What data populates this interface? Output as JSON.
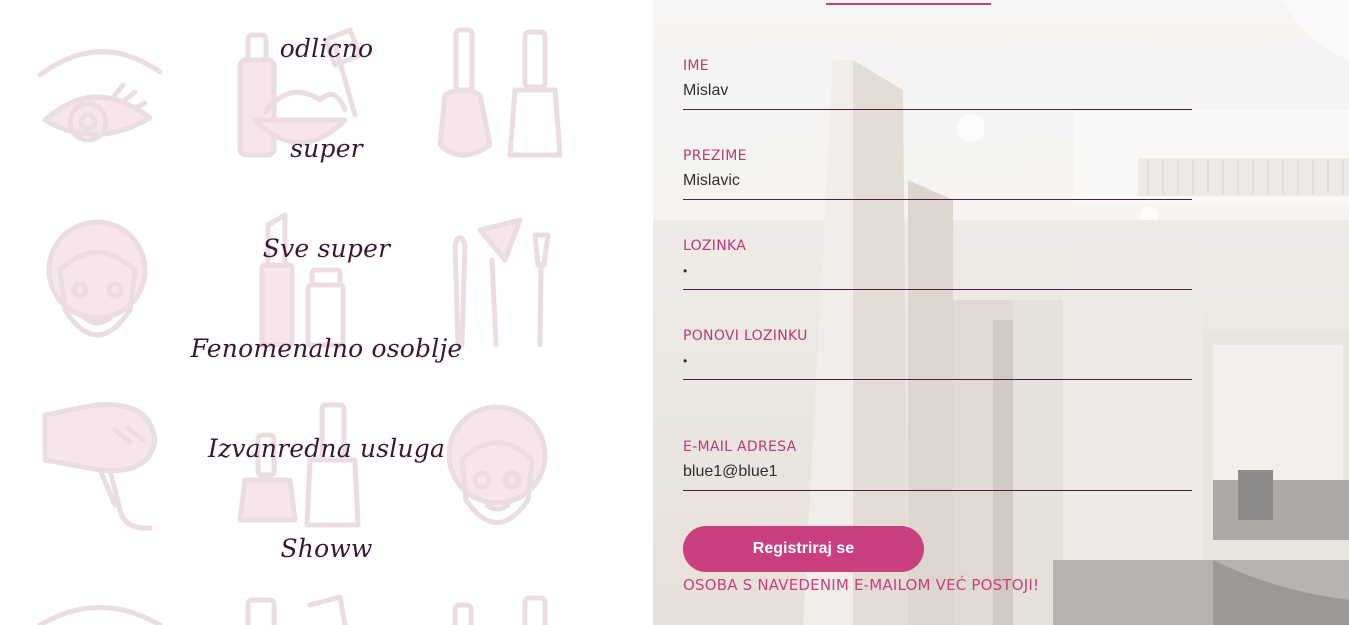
{
  "reviews": [
    "odlicno",
    "super",
    "Sve super",
    "Fenomenalno osoblje",
    "Izvanredna usluga",
    "Showw"
  ],
  "form": {
    "ime": {
      "label": "IME",
      "value": "Mislav"
    },
    "prezime": {
      "label": "PREZIME",
      "value": "Mislavic"
    },
    "lozinka": {
      "label": "LOZINKA",
      "value": "•"
    },
    "ponovi": {
      "label": "PONOVI LOZINKU",
      "value": "•"
    },
    "email": {
      "label": "E-MAIL ADRESA",
      "value": "blue1@blue1"
    },
    "submit_label": "Registriraj se",
    "error_message": "OSOBA S NAVEDENIM E-MAILOM VEĆ POSTOJI!"
  },
  "colors": {
    "accent": "#c9407f",
    "label": "#b93a74",
    "review_text": "#3d1634",
    "icon_stroke": "#ecdde4",
    "icon_fill": "#f7e6ea"
  },
  "icons": [
    "eye-makeup-icon",
    "cosmetics-bowl-icon",
    "nail-polish-icon",
    "face-mask-icon",
    "lipstick-icon",
    "makeup-brushes-icon",
    "hair-dryer-icon",
    "nail-polish-icon-2",
    "face-mask-icon-2"
  ]
}
